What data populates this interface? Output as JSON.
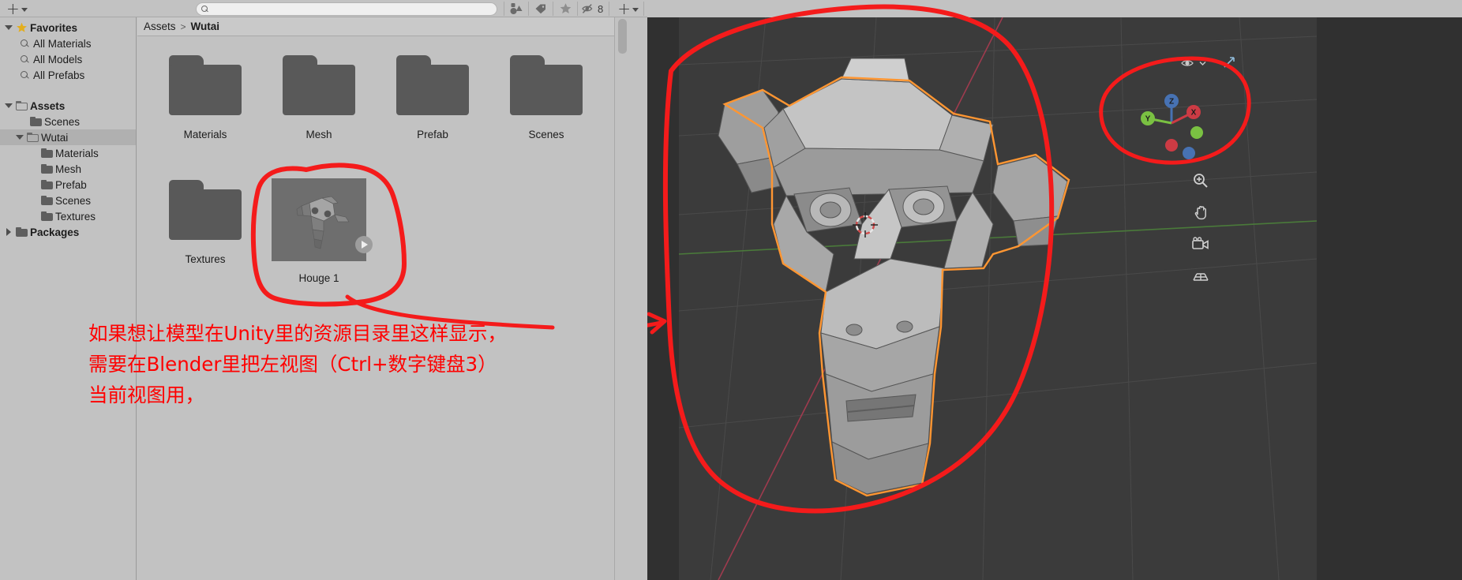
{
  "window": {
    "title": "Unity Project Browser"
  },
  "toolbar": {
    "create_label": "+",
    "create_dropdown_icon": "chevron-down-icon",
    "search": {
      "value": "",
      "placeholder": ""
    },
    "search_icon": "search-icon",
    "filter_by_type_icon": "shapes-filter-icon",
    "filter_by_label_icon": "tag-icon",
    "favorite_icon": "star-icon",
    "hidden_icon": "eye-slash-icon",
    "hidden_count": "8",
    "add_icon": "plus-icon",
    "add_dropdown_icon": "chevron-down-icon",
    "secondary_search_icon": "search-icon"
  },
  "sidebar": {
    "items": [
      {
        "label": "Favorites",
        "icon": "star-icon",
        "indent": 0,
        "twisty": "expanded",
        "bold": true,
        "selected": false
      },
      {
        "label": "All Materials",
        "icon": "search-icon",
        "indent": 1,
        "twisty": "none",
        "bold": false,
        "selected": false
      },
      {
        "label": "All Models",
        "icon": "search-icon",
        "indent": 1,
        "twisty": "none",
        "bold": false,
        "selected": false
      },
      {
        "label": "All Prefabs",
        "icon": "search-icon",
        "indent": 1,
        "twisty": "none",
        "bold": false,
        "selected": false
      },
      {
        "label": "",
        "icon": "none",
        "indent": 0,
        "twisty": "none",
        "bold": false,
        "selected": false
      },
      {
        "label": "Assets",
        "icon": "folder-open-icon",
        "indent": 0,
        "twisty": "expanded",
        "bold": true,
        "selected": false
      },
      {
        "label": "Scenes",
        "icon": "folder-icon",
        "indent": 1,
        "twisty": "none",
        "bold": false,
        "selected": false
      },
      {
        "label": "Wutai",
        "icon": "folder-open-icon",
        "indent": 1,
        "twisty": "expanded",
        "bold": false,
        "selected": true
      },
      {
        "label": "Materials",
        "icon": "folder-icon",
        "indent": 2,
        "twisty": "none",
        "bold": false,
        "selected": false
      },
      {
        "label": "Mesh",
        "icon": "folder-icon",
        "indent": 2,
        "twisty": "none",
        "bold": false,
        "selected": false
      },
      {
        "label": "Prefab",
        "icon": "folder-icon",
        "indent": 2,
        "twisty": "none",
        "bold": false,
        "selected": false
      },
      {
        "label": "Scenes",
        "icon": "folder-icon",
        "indent": 2,
        "twisty": "none",
        "bold": false,
        "selected": false
      },
      {
        "label": "Textures",
        "icon": "folder-icon",
        "indent": 2,
        "twisty": "none",
        "bold": false,
        "selected": false
      },
      {
        "label": "Packages",
        "icon": "folder-icon",
        "indent": 0,
        "twisty": "collapsed",
        "bold": true,
        "selected": false
      }
    ]
  },
  "breadcrumb": {
    "root": "Assets",
    "separator": ">",
    "current": "Wutai"
  },
  "assets": [
    {
      "name": "Materials",
      "kind": "folder"
    },
    {
      "name": "Mesh",
      "kind": "folder"
    },
    {
      "name": "Prefab",
      "kind": "folder"
    },
    {
      "name": "Scenes",
      "kind": "folder"
    },
    {
      "name": "Textures",
      "kind": "folder"
    },
    {
      "name": "Houge 1",
      "kind": "model",
      "has_preview_badge": true
    }
  ],
  "annotation": {
    "color": "#ff0000",
    "lines": [
      "如果想让模型在Unity里的资源目录里这样显示，",
      "需要在Blender里把左视图（Ctrl+数字键盘3）",
      "当前视图用，"
    ],
    "circle_target": "Houge 1",
    "arrow_target": "blender-viewport"
  },
  "blender": {
    "gizmo": {
      "axes": [
        {
          "label": "Z",
          "color": "#4772b3"
        },
        {
          "label": "X",
          "color": "#cc3b44"
        },
        {
          "label": "Y",
          "color": "#7ac142"
        }
      ]
    },
    "tools": [
      {
        "name": "toggle-xray-icon"
      },
      {
        "name": "zoom-icon"
      },
      {
        "name": "pan-hand-icon"
      },
      {
        "name": "camera-view-icon"
      },
      {
        "name": "toggle-ortho-icon"
      }
    ],
    "overlay_dropdown_icon": "chevron-down-icon",
    "back_arrow_icon": "arrow-left-icon",
    "selection_outline_color": "#ff9632",
    "background_color": "#3b3b3b"
  }
}
